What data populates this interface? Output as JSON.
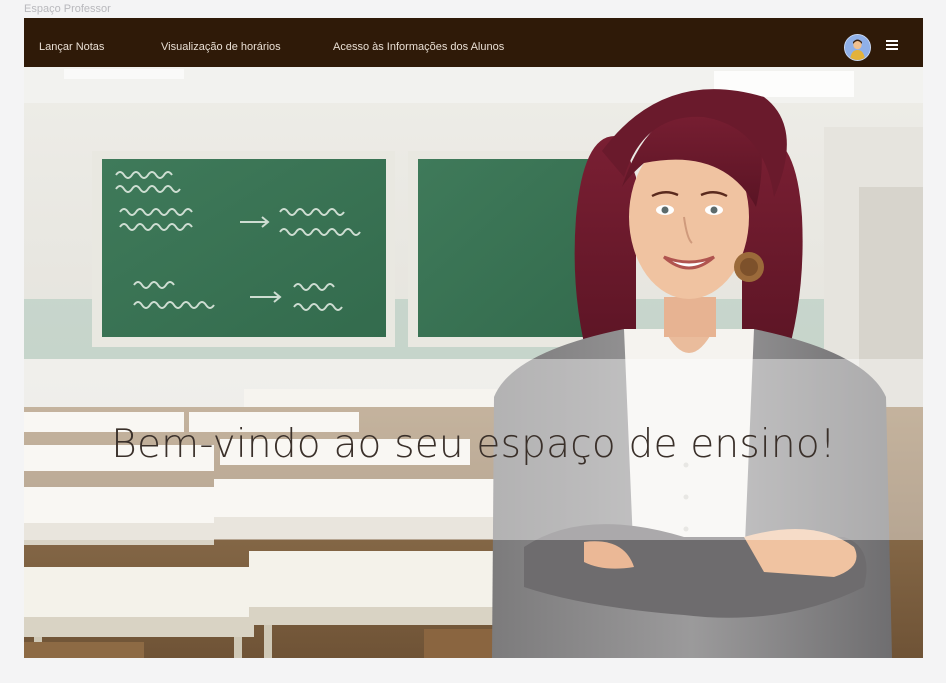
{
  "canvas": {
    "label": "Espaço Professor"
  },
  "navbar": {
    "links": [
      {
        "label": "Lançar Notas"
      },
      {
        "label": "Visualização de horários"
      },
      {
        "label": "Acesso às Informações dos Alunos"
      }
    ],
    "avatar_icon": "user-avatar",
    "menu_icon": "hamburger-menu",
    "background": "#2f1a08"
  },
  "hero": {
    "image": "teacher-in-classroom-photo",
    "welcome_text": "Bem-vindo ao seu espaço de ensino!"
  }
}
